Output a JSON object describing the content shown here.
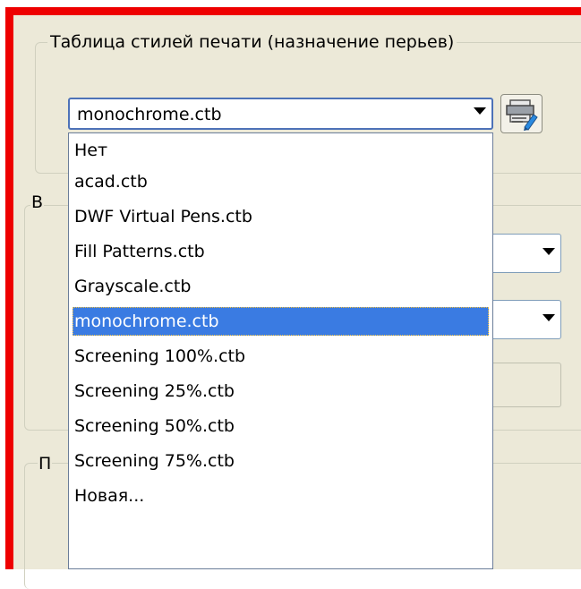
{
  "plot_style_group": {
    "title": "Таблица стилей печати (назначение перьев)",
    "selected_value": "monochrome.ctb",
    "options": [
      "Нет",
      "acad.ctb",
      "DWF Virtual Pens.ctb",
      "Fill Patterns.ctb",
      "Grayscale.ctb",
      "monochrome.ctb",
      "Screening 100%.ctb",
      "Screening 25%.ctb",
      "Screening 50%.ctb",
      "Screening 75%.ctb",
      "Новая..."
    ],
    "selected_index": 5
  },
  "clipped_labels": {
    "group2_label": "В",
    "group3_label": "П"
  },
  "colors": {
    "highlight": "#3a7be2",
    "annotation_border": "#ee0000",
    "panel_bg": "#ece9d8"
  },
  "icons": {
    "edit_button": "plotter-edit-icon"
  }
}
